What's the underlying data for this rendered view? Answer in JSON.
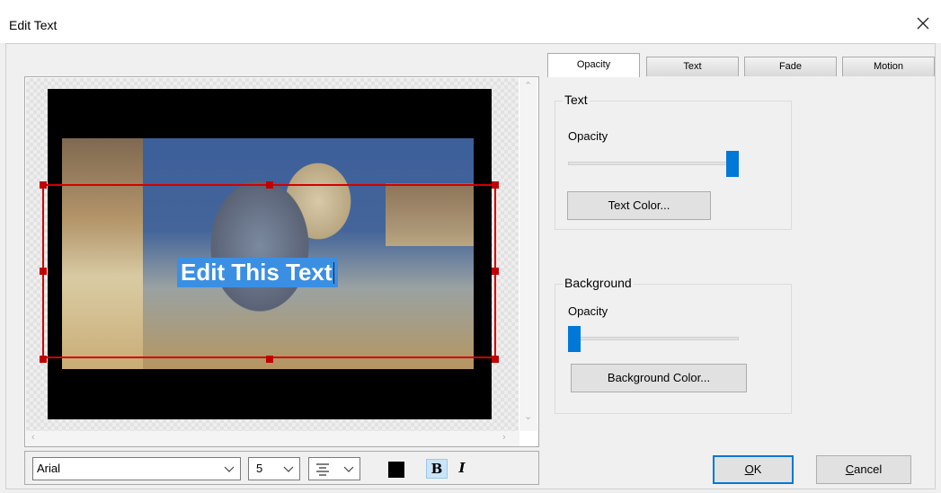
{
  "window": {
    "title": "Edit Text"
  },
  "preview": {
    "caption_text": "Edit This Text"
  },
  "toolbar": {
    "font": "Arial",
    "size": "5",
    "text_color": "#000000",
    "bold_label": "B",
    "italic_label": "I",
    "bold_active": true
  },
  "tabs": [
    {
      "label": "Opacity",
      "active": true
    },
    {
      "label": "Text",
      "active": false
    },
    {
      "label": "Fade",
      "active": false
    },
    {
      "label": "Motion",
      "active": false
    }
  ],
  "opacity_tab": {
    "text_group": {
      "title": "Text",
      "opacity_label": "Opacity",
      "opacity_value": 1.0,
      "color_button": "Text Color..."
    },
    "background_group": {
      "title": "Background",
      "opacity_label": "Opacity",
      "opacity_value": 0.0,
      "color_button": "Background Color..."
    }
  },
  "buttons": {
    "ok_u": "O",
    "ok_rest": "K",
    "cancel_u": "C",
    "cancel_rest": "ancel"
  },
  "colors": {
    "accent": "#0078d7",
    "selection": "#3b8fe3",
    "handles": "#d40000"
  }
}
